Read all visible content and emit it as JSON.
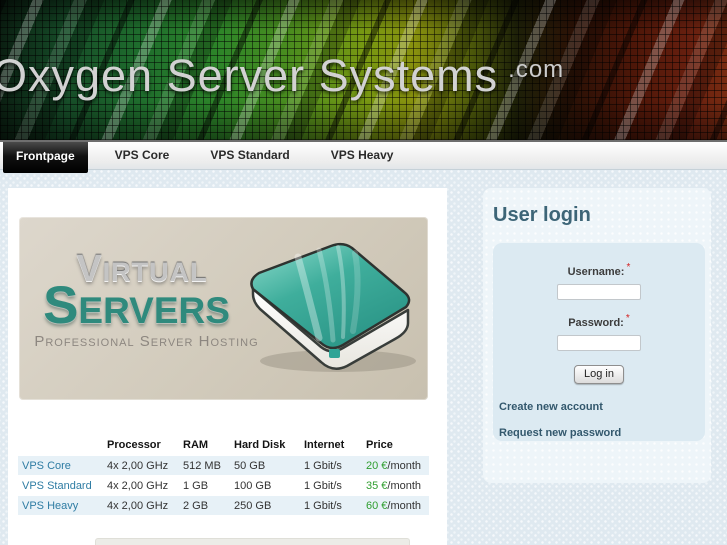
{
  "site": {
    "logo": "Oxygen Server Systems",
    "logo_suffix": ".com"
  },
  "nav": {
    "tabs": [
      {
        "label": "Frontpage",
        "active": true
      },
      {
        "label": "VPS Core",
        "active": false
      },
      {
        "label": "VPS Standard",
        "active": false
      },
      {
        "label": "VPS Heavy",
        "active": false
      }
    ]
  },
  "banner": {
    "title_top": "Virtual",
    "title_main": "Servers",
    "subtitle": "Professional Server Hosting",
    "illustration": "teal-server-drive"
  },
  "pricing": {
    "headers": [
      "",
      "Processor",
      "RAM",
      "Hard Disk",
      "Internet",
      "Price"
    ],
    "rows": [
      {
        "name": "VPS Core",
        "processor": "4x 2,00 GHz",
        "ram": "512 MB",
        "hard_disk": "50 GB",
        "internet": "1 Gbit/s",
        "price": "20 €",
        "price_suffix": "/month"
      },
      {
        "name": "VPS Standard",
        "processor": "4x 2,00 GHz",
        "ram": "1 GB",
        "hard_disk": "100 GB",
        "internet": "1 Gbit/s",
        "price": "35 €",
        "price_suffix": "/month"
      },
      {
        "name": "VPS Heavy",
        "processor": "4x 2,00 GHz",
        "ram": "2 GB",
        "hard_disk": "250 GB",
        "internet": "1 Gbit/s",
        "price": "60 €",
        "price_suffix": "/month"
      }
    ]
  },
  "login": {
    "title": "User login",
    "username_label": "Username:",
    "password_label": "Password:",
    "required_marker": "*",
    "username_value": "",
    "password_value": "",
    "button_label": "Log in",
    "links": [
      {
        "label": "Create new account"
      },
      {
        "label": "Request new password"
      }
    ]
  },
  "colors": {
    "price_green": "#2f9e2f",
    "table_link_blue": "#2e7ca3",
    "sidebar_link": "#33586d",
    "heading_slate": "#3d6577",
    "required_red": "#d42020",
    "active_tab_bg": "#000000"
  }
}
